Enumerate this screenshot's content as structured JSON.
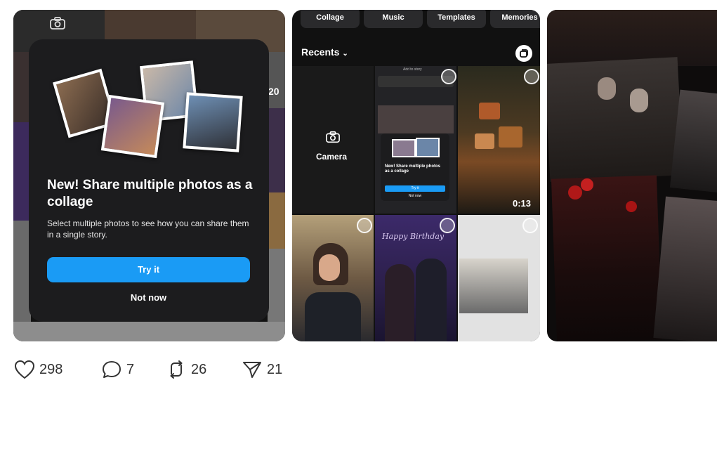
{
  "post": {
    "card1": {
      "modal": {
        "title": "New! Share multiple photos as a collage",
        "description": "Select multiple photos to see how you can share them in a single story.",
        "primary_button": "Try it",
        "secondary_button": "Not now"
      },
      "partial_text": "20"
    },
    "card2": {
      "tabs": [
        "Collage",
        "Music",
        "Templates",
        "Memories"
      ],
      "recents_label": "Recents",
      "camera_label": "Camera",
      "video_duration": "0:13",
      "thumb_inner": {
        "header": "Add to story",
        "title": "New! Share multiple photos as a collage",
        "button": "Try it",
        "link": "Not now"
      }
    }
  },
  "actions": {
    "likes": "298",
    "comments": "7",
    "reposts": "26",
    "shares": "21"
  },
  "colors": {
    "accent": "#1a9bf5",
    "modal_bg": "#1c1c1e",
    "icon_color": "#333333"
  }
}
